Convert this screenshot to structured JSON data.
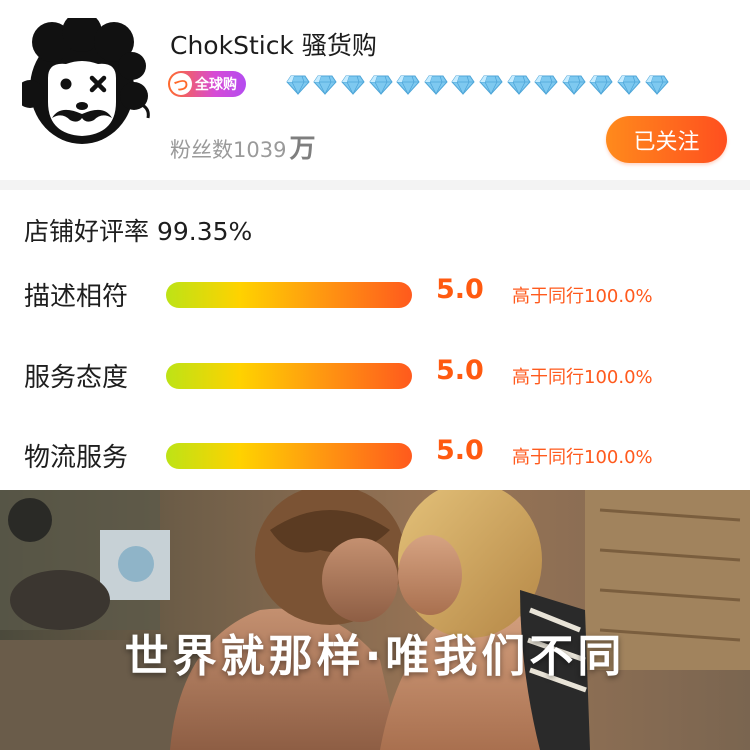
{
  "shop": {
    "name": "ChokStick 骚货购",
    "badge_text": "全球购",
    "badge_icon_letter": "つ",
    "diamond_count": 14,
    "fans_label": "粉丝数1039",
    "fans_unit": "万",
    "follow_label": "已关注"
  },
  "ratings": {
    "title": "店铺好评率 99.35%",
    "rows": [
      {
        "label": "描述相符",
        "score": "5.0",
        "compare": "高于同行100.0%"
      },
      {
        "label": "服务态度",
        "score": "5.0",
        "compare": "高于同行100.0%"
      },
      {
        "label": "物流服务",
        "score": "5.0",
        "compare": "高于同行100.0%"
      }
    ]
  },
  "banner": {
    "slogan": "世界就那样·唯我们不同"
  },
  "colors": {
    "accent_orange": "#ff5a10",
    "follow_start": "#ff8a1c",
    "follow_end": "#ff4f1f",
    "diamond": "#7ec9f0"
  }
}
